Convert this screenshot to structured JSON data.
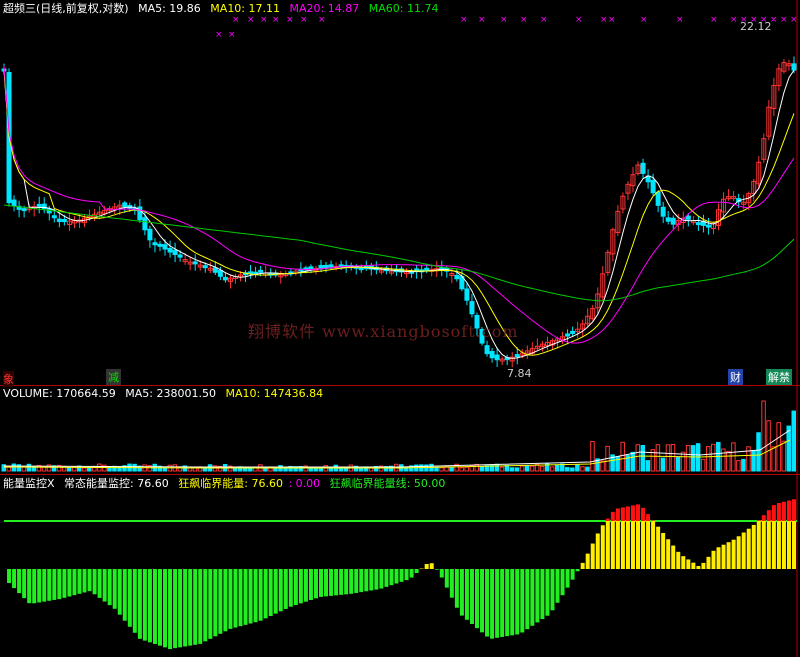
{
  "price_panel": {
    "title": "超频三(日线,前复权,对数)",
    "ma5": "MA5: 19.86",
    "ma10": "MA10: 17.11",
    "ma20": "MA20: 14.87",
    "ma60": "MA60: 11.74",
    "high_label": "22.12",
    "low_label": "7.84",
    "watermark": "翔博软件 www.xiangbosoft.com",
    "marker_left": "象",
    "marker_jian": "减",
    "marker_cai": "财",
    "marker_right": "解禁",
    "colors": {
      "up": "#ff3333",
      "down": "#00e5ff",
      "ma5": "#ffffff",
      "ma10": "#ffff00",
      "ma20": "#ff00ff",
      "ma60": "#00cc00"
    }
  },
  "volume_panel": {
    "volume": "VOLUME: 170664.59",
    "ma5": "MA5: 238001.50",
    "ma10": "MA10: 147436.84"
  },
  "energy_panel": {
    "title": "能量监控X",
    "normal": "常态能量监控: 76.60",
    "crazy": "狂飙临界能量: 76.60",
    "crazy_sub": ": 0.00",
    "line": "狂飙临界能量线: 50.00",
    "colors": {
      "green": "#22ee22",
      "yellow": "#ffee00",
      "red": "#ff1111",
      "line": "#22ee22"
    }
  },
  "chart_data": {
    "type": "line",
    "title": "超频三(日线,前复权,对数)",
    "low": 7.84,
    "high": 22.12,
    "energy_threshold": 50.0
  }
}
